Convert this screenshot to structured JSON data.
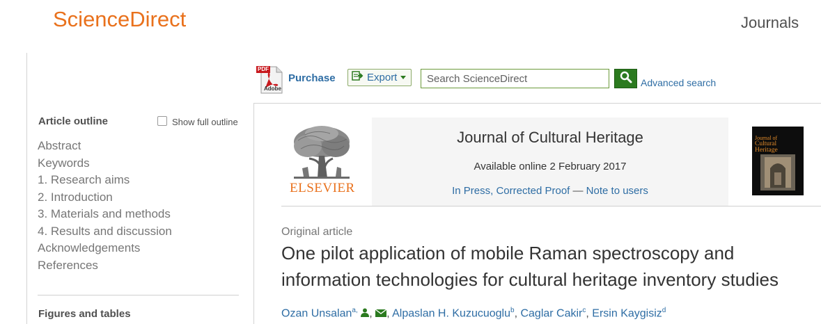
{
  "header": {
    "brand": "ScienceDirect",
    "nav_journals": "Journals"
  },
  "toolbar": {
    "purchase_label": "Purchase",
    "pdf_icon_text": "Adobe",
    "pdf_badge": "PDF",
    "export_label": "Export",
    "search_placeholder": "Search ScienceDirect",
    "advanced_search_label": "Advanced search"
  },
  "sidebar": {
    "outline_title": "Article outline",
    "show_full_outline_label": "Show full outline",
    "outline_items": [
      "Abstract",
      "Keywords",
      "1. Research aims",
      "2. Introduction",
      "3. Materials and methods",
      "4. Results and discussion",
      "Acknowledgements",
      "References"
    ],
    "figures_title": "Figures and tables"
  },
  "journal": {
    "publisher_logo_text": "ELSEVIER",
    "title": "Journal of Cultural Heritage",
    "available_online": "Available online 2 February 2017",
    "status": "In Press, Corrected Proof",
    "status_separator": "—",
    "note_link": "Note to users",
    "cover_title_line1": "Journal of",
    "cover_title_line2": "Cultural Heritage"
  },
  "article": {
    "type": "Original article",
    "title": "One pilot application of mobile Raman spectroscopy and information technologies for cultural heritage inventory studies",
    "authors": [
      {
        "name": "Ozan Unsalan",
        "sup": "a,"
      },
      {
        "name": "Alpaslan H. Kuzucuoglu",
        "sup": "b"
      },
      {
        "name": "Caglar Cakir",
        "sup": "c"
      },
      {
        "name": "Ersin Kaygisiz",
        "sup": "d"
      }
    ]
  },
  "colors": {
    "brand": "#e9711c",
    "link": "#2e6da4",
    "search_button": "#2b7a1f",
    "elsevier": "#e9711c"
  }
}
